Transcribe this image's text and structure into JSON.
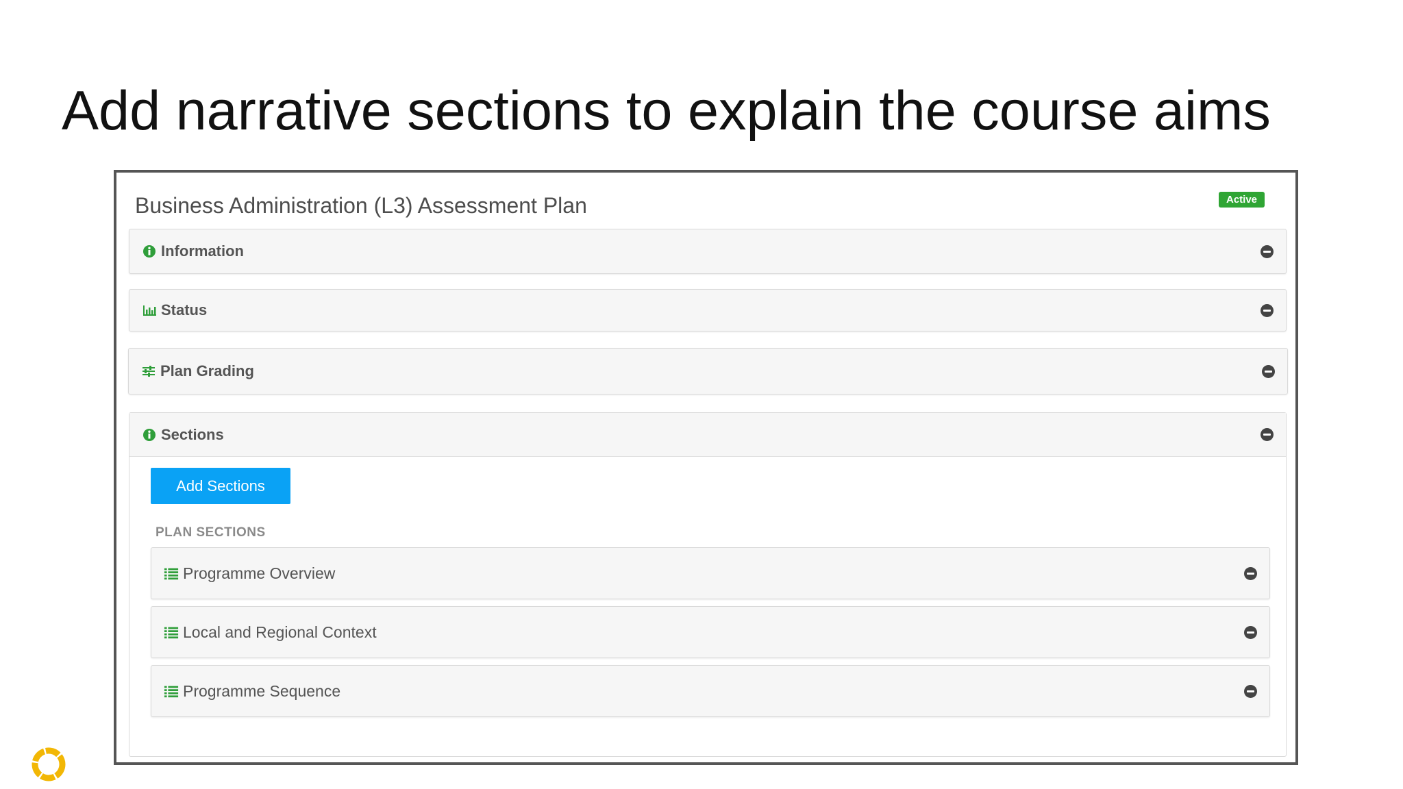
{
  "slide": {
    "title": "Add narrative sections to explain the course aims"
  },
  "plan": {
    "title": "Business Administration (L3) Assessment Plan",
    "status_badge": "Active",
    "status_badge_color": "#2fa534"
  },
  "panels": [
    {
      "label": "Information",
      "icon": "info-circle-icon"
    },
    {
      "label": "Status",
      "icon": "bar-chart-icon"
    },
    {
      "label": "Plan Grading",
      "icon": "sliders-icon"
    },
    {
      "label": "Sections",
      "icon": "info-circle-icon"
    }
  ],
  "sections": {
    "add_button_label": "Add Sections",
    "add_button_color": "#0aa2f5",
    "list_heading": "PLAN SECTIONS",
    "items": [
      {
        "label": "Programme Overview",
        "icon": "list-icon"
      },
      {
        "label": "Local and Regional Context",
        "icon": "list-icon"
      },
      {
        "label": "Programme Sequence",
        "icon": "list-icon"
      }
    ]
  },
  "colors": {
    "icon_green": "#2f9e3a",
    "logo_yellow": "#f2b705"
  }
}
